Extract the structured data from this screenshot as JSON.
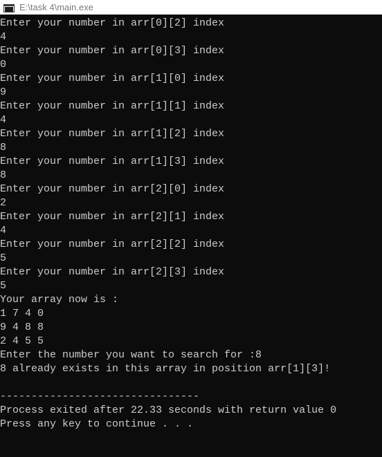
{
  "window": {
    "title": "E:\\task 4\\main.exe"
  },
  "console": {
    "lines": [
      "Enter your number in arr[0][2] index",
      "4",
      "Enter your number in arr[0][3] index",
      "0",
      "Enter your number in arr[1][0] index",
      "9",
      "Enter your number in arr[1][1] index",
      "4",
      "Enter your number in arr[1][2] index",
      "8",
      "Enter your number in arr[1][3] index",
      "8",
      "Enter your number in arr[2][0] index",
      "2",
      "Enter your number in arr[2][1] index",
      "4",
      "Enter your number in arr[2][2] index",
      "5",
      "Enter your number in arr[2][3] index",
      "5",
      "Your array now is :",
      "1 7 4 0",
      "9 4 8 8",
      "2 4 5 5",
      "Enter the number you want to search for :8",
      "8 already exists in this array in position arr[1][3]!",
      "",
      "--------------------------------",
      "Process exited after 22.33 seconds with return value 0",
      "Press any key to continue . . ."
    ]
  }
}
